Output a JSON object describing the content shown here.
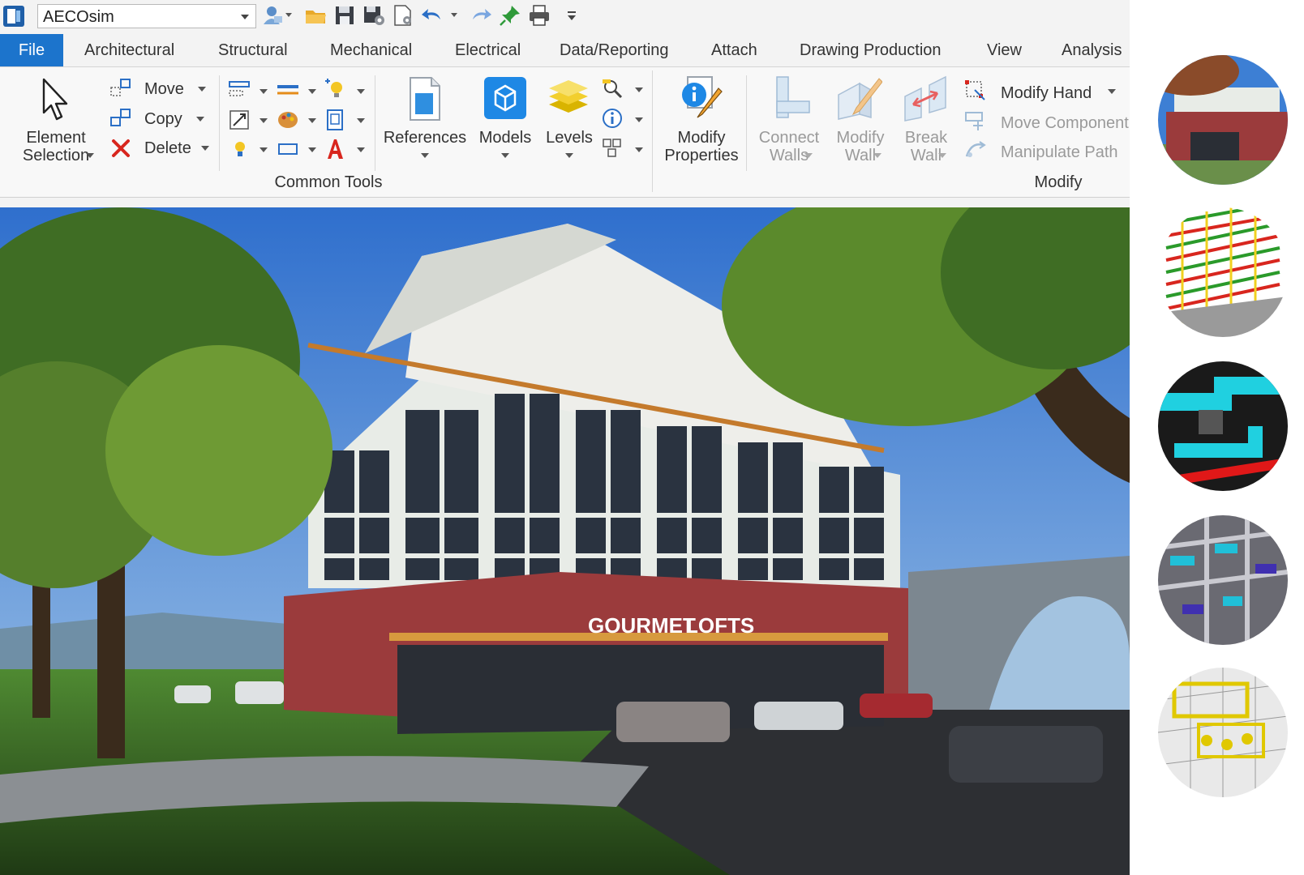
{
  "window": {
    "workflow_selector": {
      "value": "AECOsim"
    }
  },
  "quick_access": {
    "icons": [
      "user-options-icon",
      "open-folder-icon",
      "save-icon",
      "save-settings-icon",
      "properties-file-icon",
      "undo-icon",
      "redo-icon",
      "pin-icon",
      "print-icon",
      "customize-icon"
    ]
  },
  "tabs": [
    {
      "label": "File",
      "active": true
    },
    {
      "label": "Architectural"
    },
    {
      "label": "Structural"
    },
    {
      "label": "Mechanical"
    },
    {
      "label": "Electrical"
    },
    {
      "label": "Data/Reporting"
    },
    {
      "label": "Attach"
    },
    {
      "label": "Drawing Production"
    },
    {
      "label": "View"
    },
    {
      "label": "Analysis"
    }
  ],
  "ribbon": {
    "element_selection": {
      "line1": "Element",
      "line2": "Selection"
    },
    "move": "Move",
    "copy": "Copy",
    "delete": "Delete",
    "references": "References",
    "models": "Models",
    "levels": "Levels",
    "common_tools_label": "Common Tools",
    "modify_properties": {
      "line1": "Modify",
      "line2": "Properties"
    },
    "connect_walls": {
      "line1": "Connect",
      "line2": "Walls"
    },
    "modify_wall": {
      "line1": "Modify",
      "line2": "Wall"
    },
    "break_wall": {
      "line1": "Break",
      "line2": "Wall"
    },
    "modify_handle": "Modify Hand",
    "move_component": "Move Component",
    "manipulate_path": "Manipulate Path",
    "modify_label": "Modify"
  },
  "viewport": {
    "sign_text": "GOURMET",
    "sign_text_2": "LOFTS",
    "colors": {
      "brick": "#9b3b3c",
      "sky": "#3d7fd4",
      "grass": "#3f7a2a"
    }
  },
  "thumbnails": [
    {
      "name": "rendered-building"
    },
    {
      "name": "structural-frame"
    },
    {
      "name": "mechanical-ducts"
    },
    {
      "name": "floor-plan-furniture"
    },
    {
      "name": "equipment-layout"
    }
  ]
}
